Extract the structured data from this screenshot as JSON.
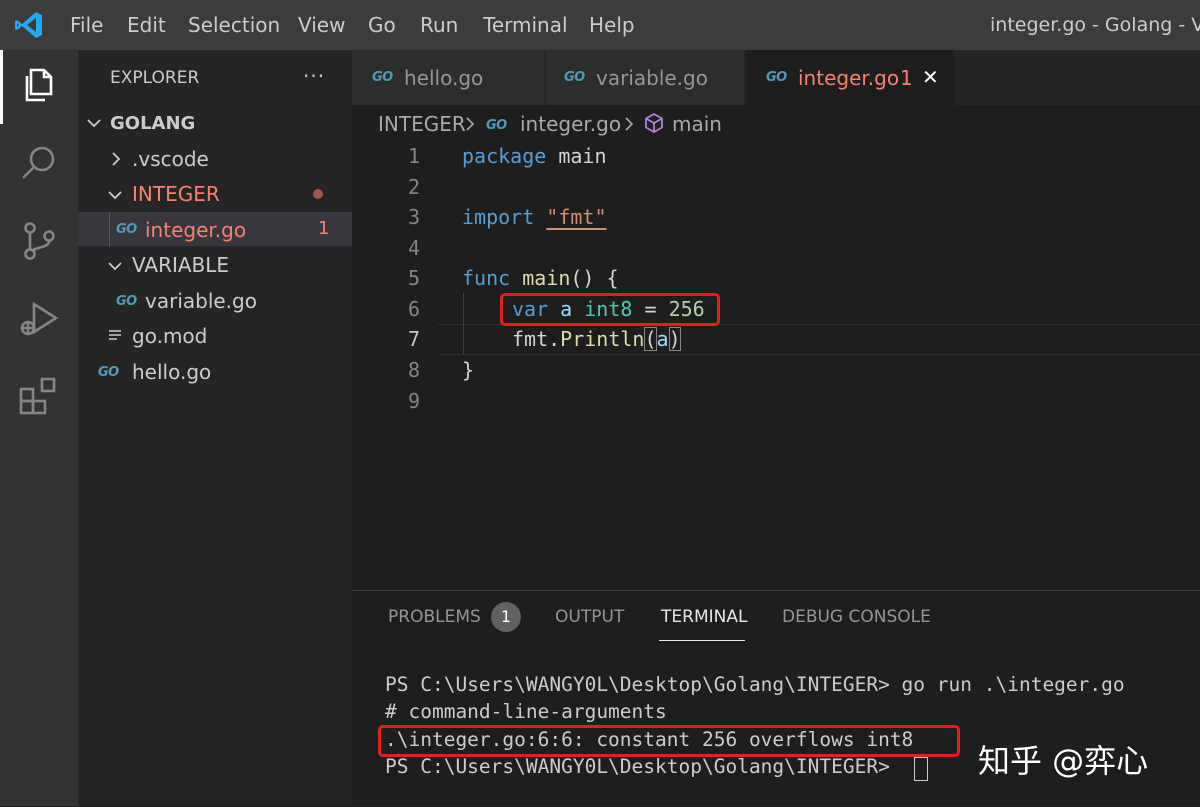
{
  "menu": [
    "File",
    "Edit",
    "Selection",
    "View",
    "Go",
    "Run",
    "Terminal",
    "Help"
  ],
  "window_title": "integer.go - Golang - Vis",
  "icons": {
    "logo": "vscode-logo-icon",
    "activity": [
      "files-icon",
      "search-icon",
      "source-control-icon",
      "run-debug-icon",
      "extensions-icon"
    ]
  },
  "explorer": {
    "title": "EXPLORER",
    "more": "···",
    "root": "GOLANG",
    "tree": {
      "vscode": ".vscode",
      "integer_folder": "INTEGER",
      "integer_file": "integer.go",
      "integer_file_badge": "1",
      "variable_folder": "VARIABLE",
      "variable_file": "variable.go",
      "gomod": "go.mod",
      "hello": "hello.go"
    },
    "go_badge": "GO"
  },
  "tabs": {
    "hello": "hello.go",
    "variable": "variable.go",
    "integer": "integer.go",
    "integer_badge": "1",
    "close": "✕"
  },
  "breadcrumb": {
    "folder": "INTEGER",
    "file": "integer.go",
    "symbol": "main"
  },
  "editor": {
    "line_numbers": [
      "1",
      "2",
      "3",
      "4",
      "5",
      "6",
      "7",
      "8",
      "9"
    ],
    "line1": {
      "kw": "package",
      "name": "main"
    },
    "line3": {
      "kw": "import",
      "str": "\"fmt\""
    },
    "line5": {
      "kw": "func",
      "fn": "main",
      "rest": "() {"
    },
    "line6": {
      "kw": "var",
      "var": "a",
      "type": "int8",
      "op": "=",
      "num": "256"
    },
    "line7": {
      "pkg": "fmt.",
      "fn": "Println",
      "open": "(",
      "arg": "a",
      "close": ")"
    },
    "line8": {
      "brace": "}"
    }
  },
  "panel": {
    "tabs": [
      "PROBLEMS",
      "OUTPUT",
      "TERMINAL",
      "DEBUG CONSOLE"
    ],
    "problems_count": "1",
    "terminal": [
      "PS C:\\Users\\WANGY0L\\Desktop\\Golang\\INTEGER> go run .\\integer.go",
      "# command-line-arguments",
      ".\\integer.go:6:6: constant 256 overflows int8",
      "PS C:\\Users\\WANGY0L\\Desktop\\Golang\\INTEGER> "
    ]
  },
  "watermark": "知乎 @弈心",
  "colors": {
    "error_modified": "#f88070",
    "highlight_box": "#e0211d",
    "go_icon": "#519aba"
  }
}
